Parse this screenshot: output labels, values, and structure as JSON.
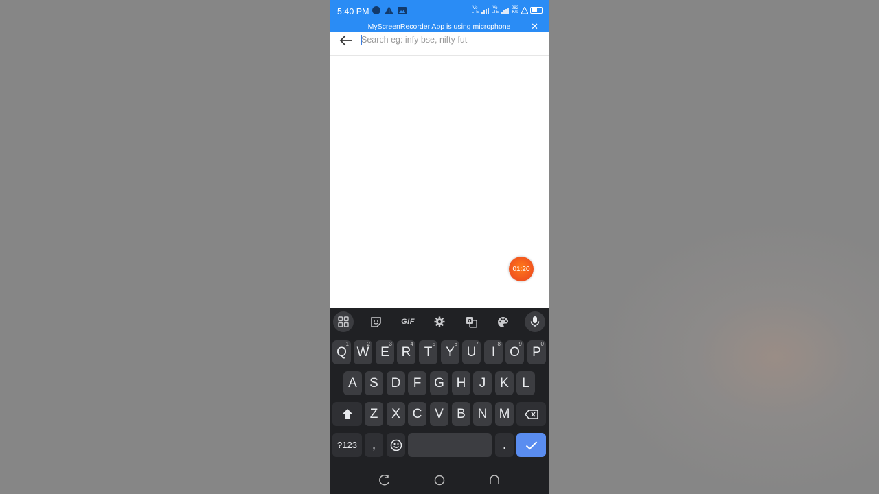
{
  "status_bar": {
    "time": "5:40 PM",
    "left_icons": [
      "notification-dot-icon",
      "warning-icon",
      "image-icon"
    ],
    "sim1_label": "Vo LTE",
    "sim2_label": "Vo LTE",
    "data_speed": "282 K/s",
    "right_icons": [
      "signal-icon",
      "signal-icon",
      "alarm-icon",
      "battery-icon"
    ]
  },
  "recording_banner": {
    "text": "MyScreenRecorder App is using microphone",
    "close_icon": "close-icon"
  },
  "search": {
    "placeholder": "Search eg: infy bse, nifty fut",
    "value": "",
    "back_icon": "back-arrow-icon"
  },
  "timer": {
    "label": "01:20"
  },
  "keyboard": {
    "toolbar": [
      {
        "name": "apps-grid-icon"
      },
      {
        "name": "sticker-icon"
      },
      {
        "name": "gif-button",
        "label": "GIF"
      },
      {
        "name": "settings-gear-icon"
      },
      {
        "name": "translate-icon"
      },
      {
        "name": "theme-palette-icon"
      },
      {
        "name": "microphone-icon"
      }
    ],
    "rows": [
      [
        {
          "label": "Q",
          "hint": "1"
        },
        {
          "label": "W",
          "hint": "2"
        },
        {
          "label": "E",
          "hint": "3"
        },
        {
          "label": "R",
          "hint": "4"
        },
        {
          "label": "T",
          "hint": "5"
        },
        {
          "label": "Y",
          "hint": "6"
        },
        {
          "label": "U",
          "hint": "7"
        },
        {
          "label": "I",
          "hint": "8"
        },
        {
          "label": "O",
          "hint": "9"
        },
        {
          "label": "P",
          "hint": "0"
        }
      ],
      [
        {
          "label": "A"
        },
        {
          "label": "S"
        },
        {
          "label": "D"
        },
        {
          "label": "F"
        },
        {
          "label": "G"
        },
        {
          "label": "H"
        },
        {
          "label": "J"
        },
        {
          "label": "K"
        },
        {
          "label": "L"
        }
      ],
      [
        {
          "label": "Z"
        },
        {
          "label": "X"
        },
        {
          "label": "C"
        },
        {
          "label": "V"
        },
        {
          "label": "B"
        },
        {
          "label": "N"
        },
        {
          "label": "M"
        }
      ]
    ],
    "symbols_label": "?123",
    "comma_label": ",",
    "period_label": ".",
    "shift_icon": "shift-arrow-icon",
    "backspace_icon": "backspace-icon",
    "emoji_icon": "emoji-icon",
    "enter_icon": "checkmark-icon",
    "accent_color": "#5a8df0"
  },
  "nav_bar": {
    "buttons": [
      "recents-icon",
      "home-icon",
      "back-icon"
    ]
  },
  "colors": {
    "status_bar": "#2a8cf5",
    "keyboard_bg": "#202124",
    "key_bg": "#3c3d41",
    "timer": "#f0521f"
  }
}
